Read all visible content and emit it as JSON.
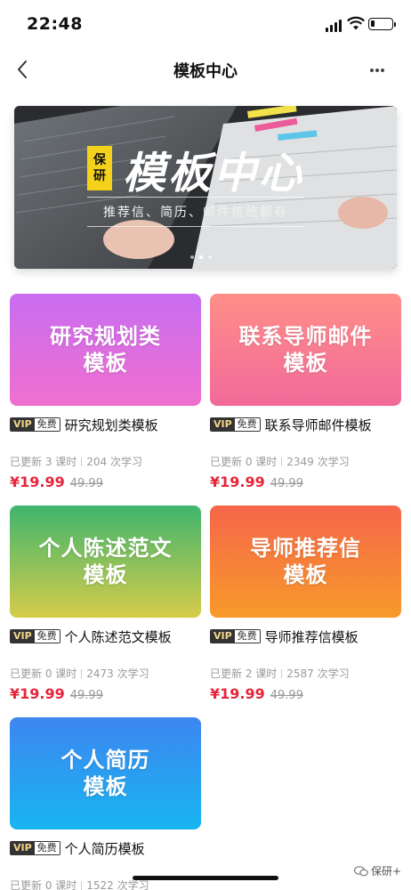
{
  "status_bar": {
    "time": "22:48",
    "battery_level": 0.2
  },
  "nav": {
    "title": "模板中心"
  },
  "banner": {
    "badge": [
      "保",
      "研"
    ],
    "title": "模板中心",
    "subtitle": "推荐信、简历、邮件统统都有"
  },
  "cards": [
    {
      "cover_lines": [
        "研究规划类",
        "模板"
      ],
      "vip": "VIP",
      "free": "免费",
      "title": "研究规划类模板",
      "updated": "已更新 3 课时",
      "learners": "204 次学习",
      "price": "¥19.99",
      "original_price": "49.99",
      "gradient": [
        "#c86df1",
        "#f06fd0"
      ]
    },
    {
      "cover_lines": [
        "联系导师邮件",
        "模板"
      ],
      "vip": "VIP",
      "free": "免费",
      "title": "联系导师邮件模板",
      "updated": "已更新 0 课时",
      "learners": "2349 次学习",
      "price": "¥19.99",
      "original_price": "49.99",
      "gradient": [
        "#ff8f88",
        "#f26a9a"
      ]
    },
    {
      "cover_lines": [
        "个人陈述范文",
        "模板"
      ],
      "vip": "VIP",
      "free": "免费",
      "title": "个人陈述范文模板",
      "updated": "已更新 0 课时",
      "learners": "2473 次学习",
      "price": "¥19.99",
      "original_price": "49.99",
      "gradient": [
        "#3fb56e",
        "#d6cc4a"
      ]
    },
    {
      "cover_lines": [
        "导师推荐信",
        "模板"
      ],
      "vip": "VIP",
      "free": "免费",
      "title": "导师推荐信模板",
      "updated": "已更新 2 课时",
      "learners": "2587 次学习",
      "price": "¥19.99",
      "original_price": "49.99",
      "gradient": [
        "#f6664a",
        "#f79a2a"
      ]
    },
    {
      "cover_lines": [
        "个人简历",
        "模板"
      ],
      "vip": "VIP",
      "free": "免费",
      "title": "个人简历模板",
      "updated": "已更新 0 课时",
      "learners": "1522 次学习",
      "price": "",
      "original_price": "",
      "gradient": [
        "#3d86f0",
        "#18b5f0"
      ]
    }
  ],
  "watermark": {
    "text": "保研+"
  }
}
